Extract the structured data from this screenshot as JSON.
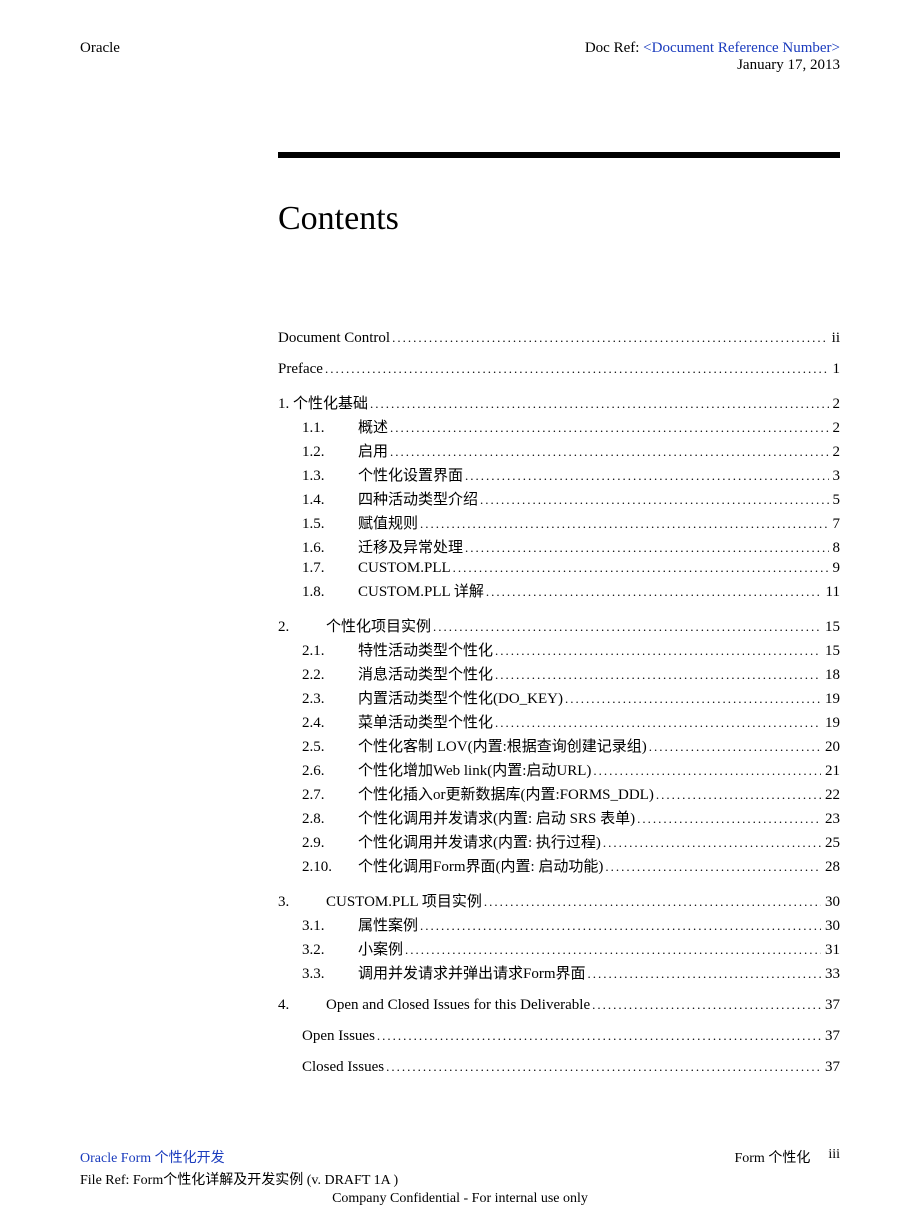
{
  "header": {
    "left": "Oracle",
    "docRefLabel": "Doc Ref:  ",
    "docRefValue": "<Document Reference Number>",
    "date": "January 17, 2013"
  },
  "title": "Contents",
  "toc": [
    {
      "level": 0,
      "num": "",
      "label": "Document Control",
      "page": "ii"
    },
    {
      "level": 0,
      "num": "",
      "label": "Preface",
      "page": "1"
    },
    {
      "level": 0,
      "num": "",
      "label": "1. 个性化基础",
      "page": "2"
    },
    {
      "level": 1,
      "num": "1.1.",
      "label": "概述",
      "page": "2"
    },
    {
      "level": 1,
      "num": "1.2.",
      "label": "启用",
      "page": "2"
    },
    {
      "level": 1,
      "num": "1.3.",
      "label": "个性化设置界面",
      "page": "3"
    },
    {
      "level": 1,
      "num": "1.4.",
      "label": "四种活动类型介绍",
      "page": "5"
    },
    {
      "level": 1,
      "num": "1.5.",
      "label": "赋值规则",
      "page": "7"
    },
    {
      "level": 1,
      "num": "1.6.",
      "label": "迁移及异常处理",
      "page": "8"
    },
    {
      "level": 1,
      "num": "1.7.",
      "label": "CUSTOM.PLL",
      "page": "9"
    },
    {
      "level": 1,
      "num": "1.8.",
      "label": "CUSTOM.PLL 详解",
      "page": "11"
    },
    {
      "level": 0,
      "num": "2.",
      "label": "个性化项目实例",
      "page": "15"
    },
    {
      "level": 1,
      "num": "2.1.",
      "label": "特性活动类型个性化",
      "page": "15"
    },
    {
      "level": 1,
      "num": "2.2.",
      "label": "消息活动类型个性化",
      "page": "18"
    },
    {
      "level": 1,
      "num": "2.3.",
      "label": "内置活动类型个性化(DO_KEY)",
      "page": "19"
    },
    {
      "level": 1,
      "num": "2.4.",
      "label": "菜单活动类型个性化",
      "page": "19"
    },
    {
      "level": 1,
      "num": "2.5.",
      "label": "个性化客制 LOV(内置:根据查询创建记录组)",
      "page": "20"
    },
    {
      "level": 1,
      "num": "2.6.",
      "label": "个性化增加Web link(内置:启动URL)",
      "page": "21"
    },
    {
      "level": 1,
      "num": "2.7.",
      "label": "个性化插入or更新数据库(内置:FORMS_DDL)",
      "page": "22"
    },
    {
      "level": 1,
      "num": "2.8.",
      "label": "个性化调用并发请求(内置: 启动 SRS 表单)",
      "page": "23"
    },
    {
      "level": 1,
      "num": "2.9.",
      "label": "个性化调用并发请求(内置: 执行过程)",
      "page": "25"
    },
    {
      "level": 1,
      "num": "2.10.",
      "label": "个性化调用Form界面(内置: 启动功能)",
      "page": "28"
    },
    {
      "level": 0,
      "num": "3.",
      "label": "CUSTOM.PLL 项目实例",
      "page": "30"
    },
    {
      "level": 1,
      "num": "3.1.",
      "label": "属性案例",
      "page": "30"
    },
    {
      "level": 1,
      "num": "3.2.",
      "label": "小案例",
      "page": "31"
    },
    {
      "level": 1,
      "num": "3.3.",
      "label": "调用并发请求并弹出请求Form界面",
      "page": "33"
    },
    {
      "level": 0,
      "num": "4.",
      "label": "Open and Closed Issues for this Deliverable",
      "page": "37"
    },
    {
      "level": 2,
      "num": "",
      "label": "Open Issues",
      "page": "37"
    },
    {
      "level": 2,
      "num": "",
      "label": "Closed Issues",
      "page": "37"
    }
  ],
  "footer": {
    "leftLink": "Oracle  Form 个性化开发",
    "rightLabel": "Form 个性化",
    "rightPage": "iii",
    "fileRef": "File Ref:  Form个性化详解及开发实例     (v. DRAFT 1A )",
    "confidential": "Company Confidential - For internal use only"
  }
}
